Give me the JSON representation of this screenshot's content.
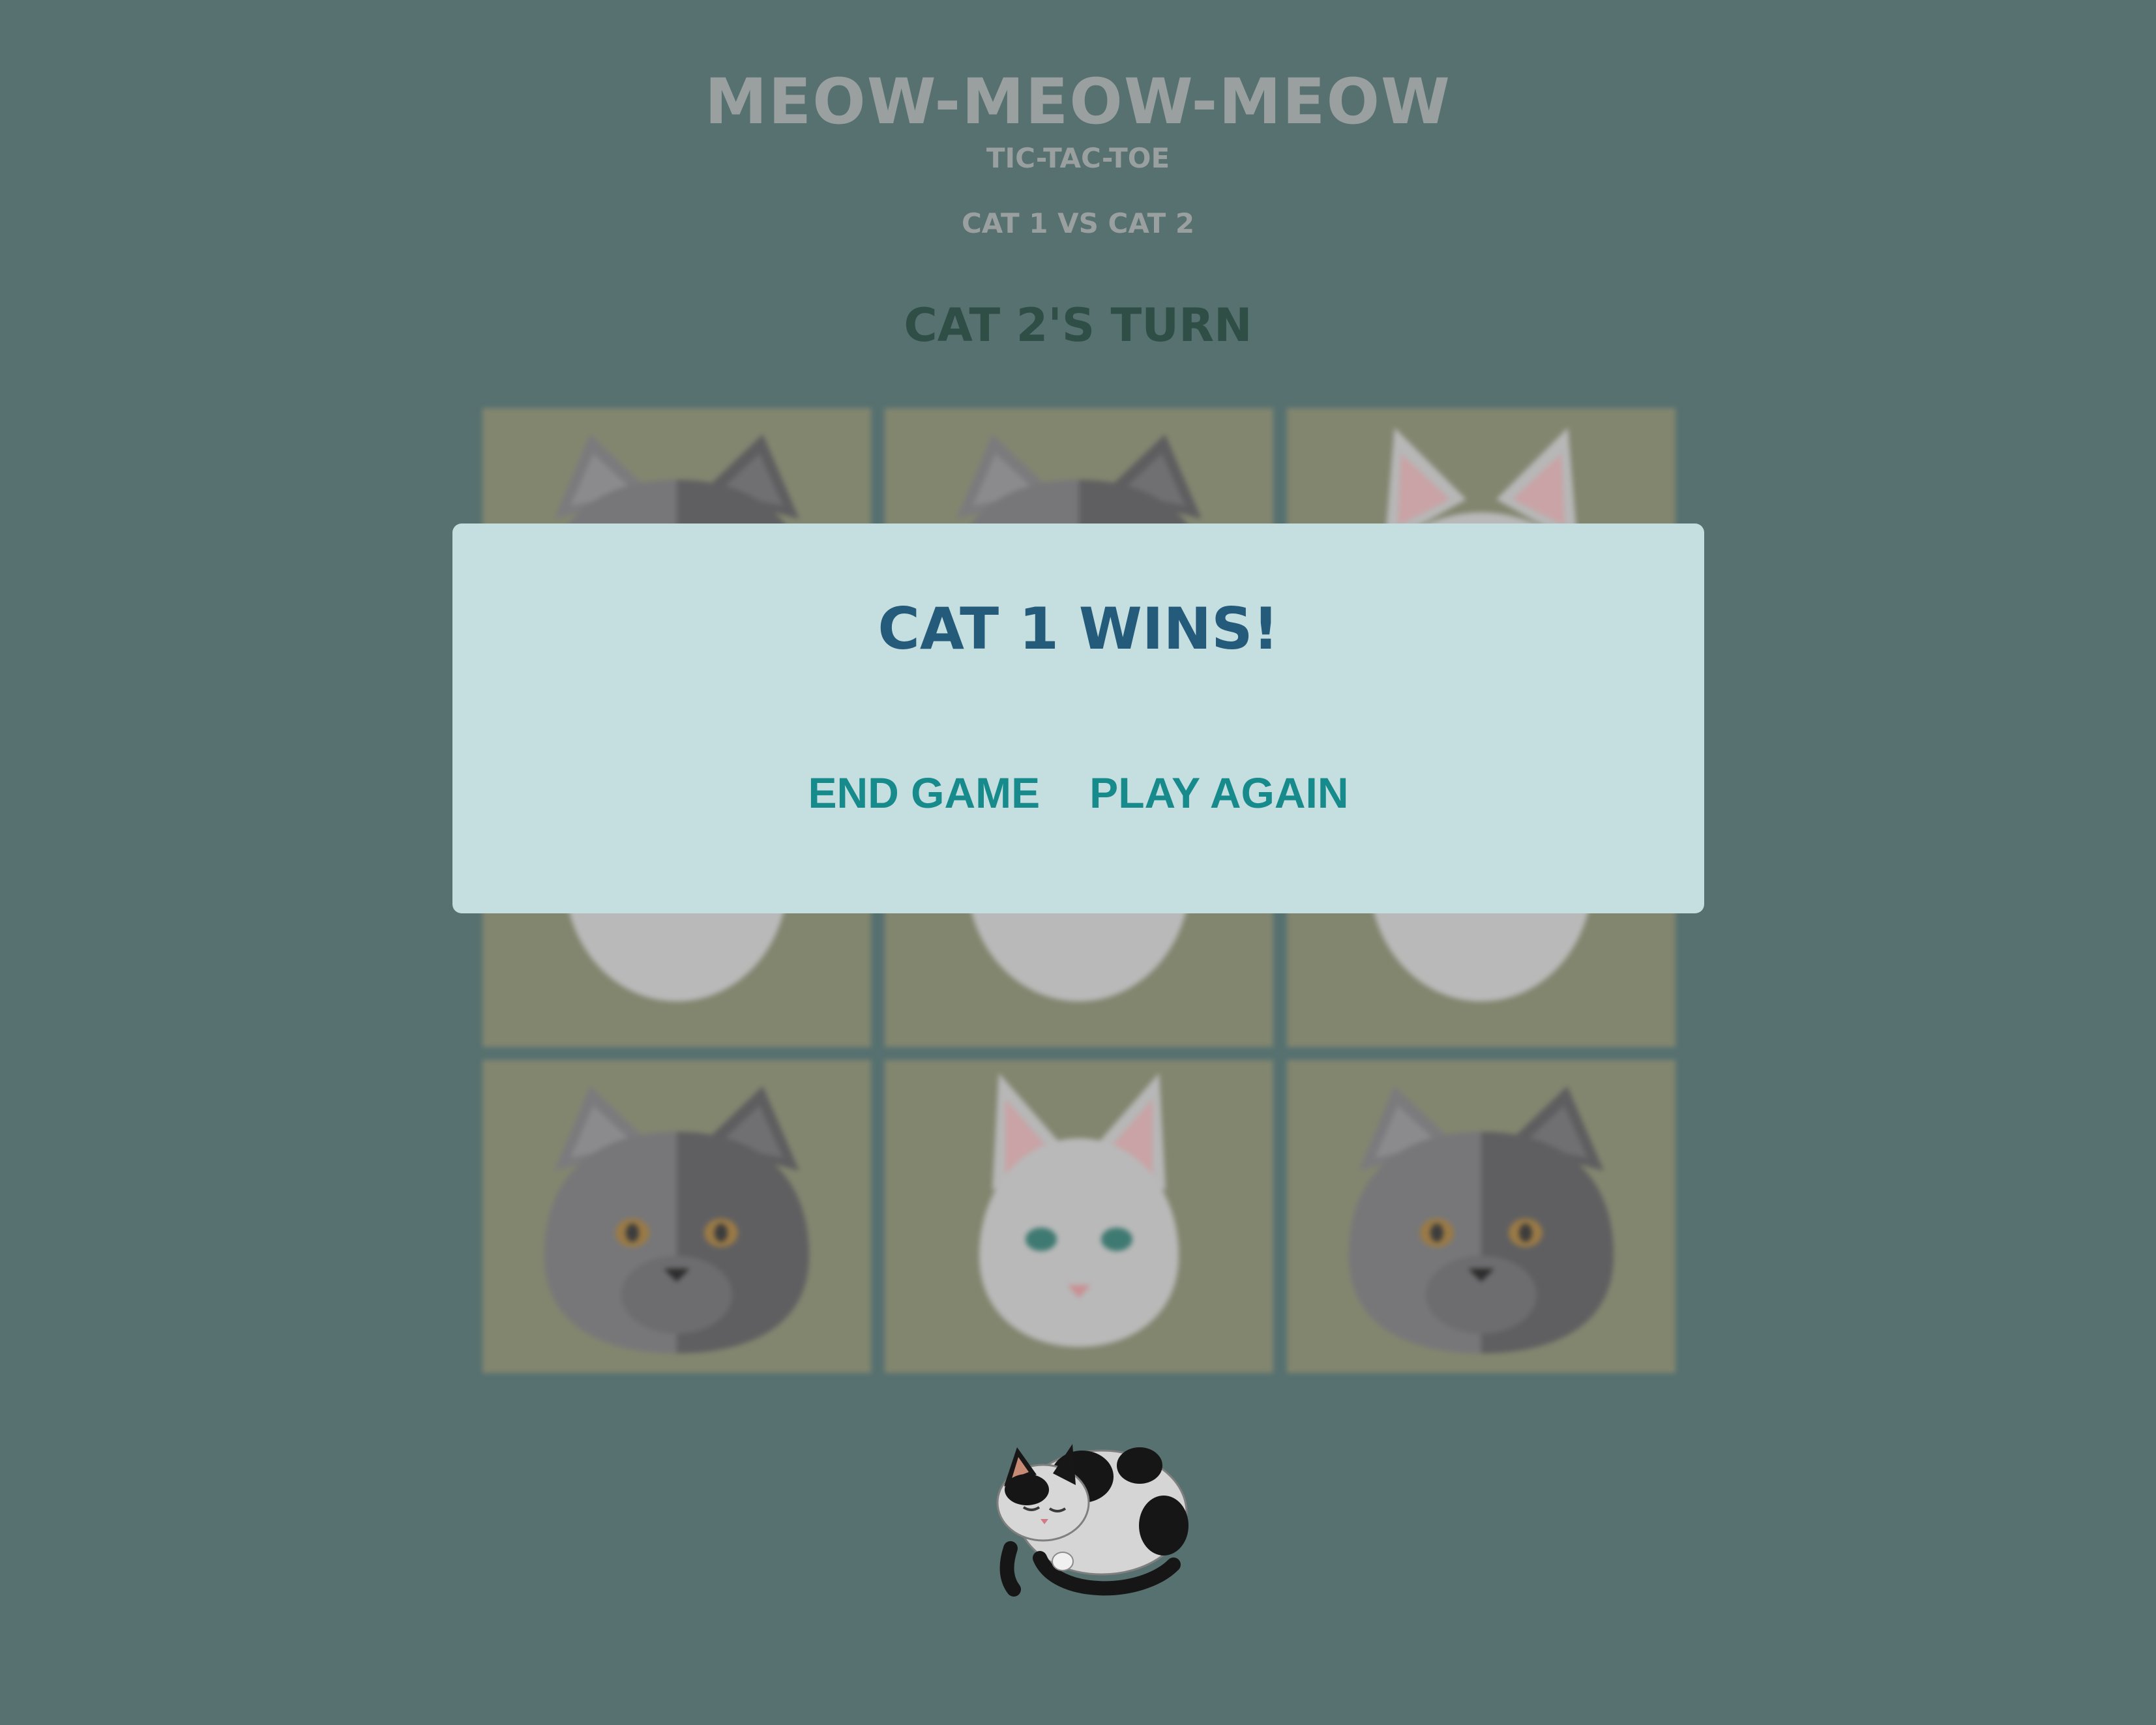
{
  "header": {
    "title": "MEOW-MEOW-MEOW",
    "subtitle": "TIC-TAC-TOE",
    "players": "CAT 1 VS CAT 2",
    "turn_status": "CAT 2'S TURN"
  },
  "board": {
    "cells": [
      "grey-cat",
      "grey-cat",
      "white-cat",
      "grey-cat",
      "grey-cat",
      "white-cat",
      "white-cat",
      "white-cat",
      "white-cat",
      "grey-cat",
      "white-cat",
      "grey-cat"
    ]
  },
  "modal": {
    "title": "CAT 1 WINS!",
    "end_game_label": "END GAME",
    "play_again_label": "PLAY AGAIN"
  },
  "colors": {
    "background": "#577170",
    "board_cell": "#82866f",
    "modal_background": "#c5dfe0",
    "modal_title": "#245a7a",
    "modal_buttons": "#178a8c"
  },
  "icons": {
    "grey_cat": "grey-cat-face-icon",
    "white_cat": "white-cat-face-icon",
    "footer_cat": "sleeping-cat-icon"
  }
}
